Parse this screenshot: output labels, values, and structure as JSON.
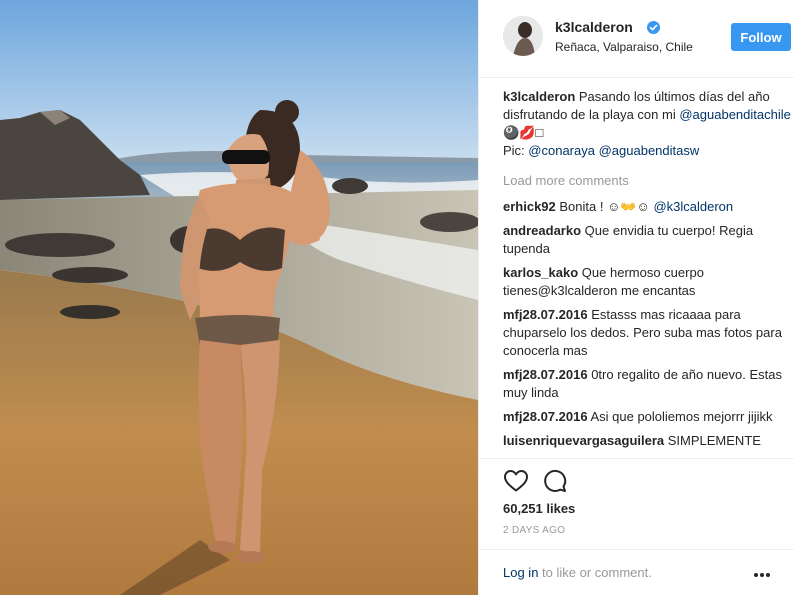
{
  "header": {
    "username": "k3lcalderon",
    "location": "Reñaca, Valparaiso, Chile",
    "follow_label": "Follow"
  },
  "caption": {
    "username": "k3lcalderon",
    "text_before": "Pasando los últimos días del año disfrutando de la playa con mi",
    "mention1": "@aguabenditachile",
    "emoji": "🎱💋□",
    "pic_label": "Pic:",
    "mention2": "@conaraya",
    "mention3": "@aguabenditasw"
  },
  "load_more_label": "Load more comments",
  "comments": [
    {
      "user": "erhick92",
      "text": "Bonita ! ☺👐☺ ",
      "mention": "@k3lcalderon"
    },
    {
      "user": "andreadarko",
      "text": "Que envidia tu cuerpo! Regia tupenda",
      "mention": ""
    },
    {
      "user": "karlos_kako",
      "text": "Que hermoso cuerpo tienes@k3lcalderon me encantas",
      "mention": ""
    },
    {
      "user": "mfj28.07.2016",
      "text": "Estasss mas ricaaaa para chuparselo los dedos. Pero suba mas fotos para conocerla mas",
      "mention": ""
    },
    {
      "user": "mfj28.07.2016",
      "text": "0tro regalito de año nuevo. Estas muy linda",
      "mention": ""
    },
    {
      "user": "mfj28.07.2016",
      "text": "Asi que pololiemos mejorrr jijikk",
      "mention": ""
    },
    {
      "user": "luisenriquevargasaguilera",
      "text": "SIMPLEMENTE",
      "mention": ""
    }
  ],
  "likes": "60,251 likes",
  "time_ago": "2 DAYS AGO",
  "footer": {
    "login_link": "Log in",
    "login_rest": " to like or comment."
  },
  "icons": {
    "verified": "verified-badge-icon",
    "heart": "heart-icon",
    "comment": "comment-icon",
    "more": "more-options-icon"
  },
  "colors": {
    "follow_button": "#3897f0",
    "mention": "#003569",
    "muted": "#999999"
  }
}
